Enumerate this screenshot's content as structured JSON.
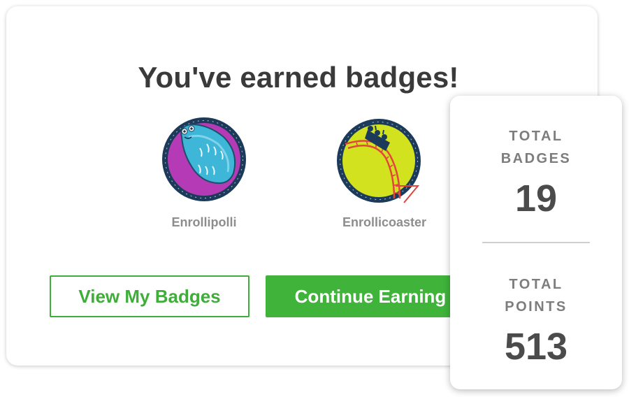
{
  "dialog": {
    "title": "You've earned badges!"
  },
  "badges": [
    {
      "name": "Enrollipolli",
      "icon": "pillbug-badge-icon",
      "colors": {
        "ring": "#1c3a5a",
        "fill": "#b53ab5",
        "creature": "#3db6d8"
      }
    },
    {
      "name": "Enrollicoaster",
      "icon": "rollercoaster-badge-icon",
      "colors": {
        "ring": "#1c3a5a",
        "fill": "#d3e21f",
        "track": "#e0463c"
      }
    }
  ],
  "buttons": {
    "view_badges": "View My Badges",
    "continue": "Continue Earning"
  },
  "stats": {
    "total_badges_label_line1": "TOTAL",
    "total_badges_label_line2": "BADGES",
    "total_badges_value": "19",
    "total_points_label_line1": "TOTAL",
    "total_points_label_line2": "POINTS",
    "total_points_value": "513"
  },
  "colors": {
    "accent_green": "#3fb33a",
    "title_text": "#3a3a3a",
    "muted_text": "#8d8d8d"
  }
}
